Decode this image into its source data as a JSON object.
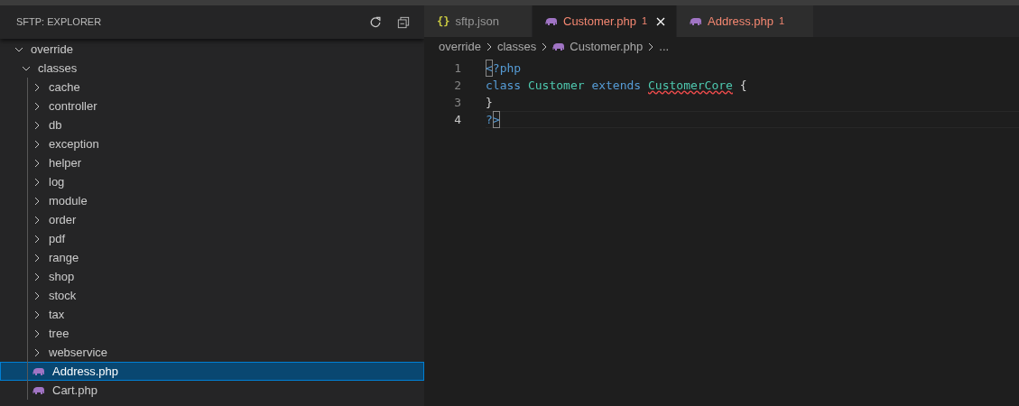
{
  "sidebar": {
    "title": "SFTP: EXPLORER",
    "tree": [
      {
        "label": "override",
        "kind": "folder",
        "expanded": true,
        "selected": false,
        "children": [
          {
            "label": "classes",
            "kind": "folder",
            "expanded": true,
            "selected": false,
            "children": [
              {
                "label": "cache",
                "kind": "folder",
                "expanded": false,
                "selected": false
              },
              {
                "label": "controller",
                "kind": "folder",
                "expanded": false,
                "selected": false
              },
              {
                "label": "db",
                "kind": "folder",
                "expanded": false,
                "selected": false
              },
              {
                "label": "exception",
                "kind": "folder",
                "expanded": false,
                "selected": false
              },
              {
                "label": "helper",
                "kind": "folder",
                "expanded": false,
                "selected": false
              },
              {
                "label": "log",
                "kind": "folder",
                "expanded": false,
                "selected": false
              },
              {
                "label": "module",
                "kind": "folder",
                "expanded": false,
                "selected": false
              },
              {
                "label": "order",
                "kind": "folder",
                "expanded": false,
                "selected": false
              },
              {
                "label": "pdf",
                "kind": "folder",
                "expanded": false,
                "selected": false
              },
              {
                "label": "range",
                "kind": "folder",
                "expanded": false,
                "selected": false
              },
              {
                "label": "shop",
                "kind": "folder",
                "expanded": false,
                "selected": false
              },
              {
                "label": "stock",
                "kind": "folder",
                "expanded": false,
                "selected": false
              },
              {
                "label": "tax",
                "kind": "folder",
                "expanded": false,
                "selected": false
              },
              {
                "label": "tree",
                "kind": "folder",
                "expanded": false,
                "selected": false
              },
              {
                "label": "webservice",
                "kind": "folder",
                "expanded": false,
                "selected": false
              },
              {
                "label": "Address.php",
                "kind": "php",
                "selected": true
              },
              {
                "label": "Cart.php",
                "kind": "php",
                "selected": false
              }
            ]
          }
        ]
      }
    ]
  },
  "tabs": [
    {
      "label": "sftp.json",
      "kind": "json",
      "icon": "{}",
      "selected": false,
      "error": false
    },
    {
      "label": "Customer.php",
      "kind": "php",
      "selected": true,
      "error": true,
      "problems": "1"
    },
    {
      "label": "Address.php",
      "kind": "php",
      "selected": false,
      "error": true,
      "problems": "1"
    }
  ],
  "breadcrumb": [
    {
      "label": "override",
      "kind": "text"
    },
    {
      "label": "classes",
      "kind": "text"
    },
    {
      "label": "Customer.php",
      "kind": "php"
    },
    {
      "label": "...",
      "kind": "text"
    }
  ],
  "code": [
    {
      "number": "1",
      "current": false,
      "tokens": [
        {
          "text": "<",
          "kind": "tag",
          "bracket_match": true
        },
        {
          "text": "?php",
          "kind": "tag"
        }
      ]
    },
    {
      "number": "2",
      "current": false,
      "tokens": [
        {
          "text": "class",
          "kind": "keyword"
        },
        {
          "text": "Customer",
          "kind": "type",
          "space_before": true
        },
        {
          "text": "extends",
          "kind": "keyword",
          "space_before": true
        },
        {
          "text": "CustomerCore",
          "kind": "type",
          "error": true,
          "space_before": true
        },
        {
          "text": "{",
          "kind": "plain",
          "space_before": true
        }
      ]
    },
    {
      "number": "3",
      "current": false,
      "tokens": [
        {
          "text": "}",
          "kind": "plain"
        }
      ]
    },
    {
      "number": "4",
      "current": true,
      "tokens": [
        {
          "text": "?",
          "kind": "tag"
        },
        {
          "text": ">",
          "kind": "tag",
          "bracket_match": true
        }
      ]
    }
  ]
}
